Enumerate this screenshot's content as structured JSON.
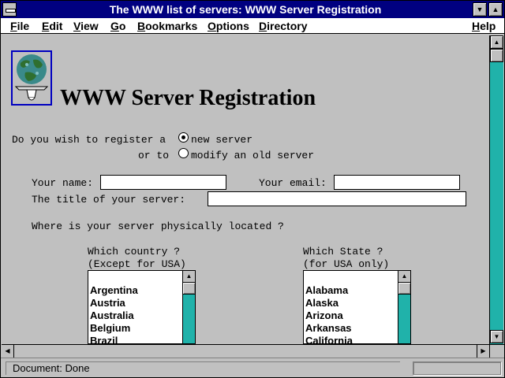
{
  "window": {
    "title": "The WWW list of servers: WWW Server Registration",
    "minimize_glyph": "▼",
    "maximize_glyph": "▲"
  },
  "menu": {
    "items": [
      {
        "label": "File"
      },
      {
        "label": "Edit"
      },
      {
        "label": "View"
      },
      {
        "label": "Go"
      },
      {
        "label": "Bookmarks"
      },
      {
        "label": "Options"
      },
      {
        "label": "Directory"
      },
      {
        "label": "Help"
      }
    ]
  },
  "page": {
    "heading": "WWW Server Registration",
    "register_prompt": "Do you wish to register a",
    "option_new": "new server",
    "or_to": "or to",
    "option_modify": "modify an old server",
    "name_label": "Your name:",
    "name_value": "",
    "email_label": "Your email:",
    "email_value": "",
    "server_title_label": "The title of your server:",
    "server_title_value": "",
    "location_question": "Where is your server physically located ?",
    "country_heading": "Which country ?",
    "country_subheading": "(Except for USA)",
    "countries": [
      "Argentina",
      "Austria",
      "Australia",
      "Belgium",
      "Brazil"
    ],
    "state_heading": "Which State ?",
    "state_subheading": "(for USA only)",
    "states": [
      "Alabama",
      "Alaska",
      "Arizona",
      "Arkansas",
      "California"
    ]
  },
  "status": {
    "text": "Document: Done"
  },
  "colors": {
    "titlebar": "#000080",
    "scrollbar_track": "#20b2aa",
    "background": "#c0c0c0"
  },
  "icons": {
    "logo": "globe-on-tray-icon",
    "scroll_up": "arrow-up-icon",
    "scroll_down": "arrow-down-icon",
    "scroll_left": "arrow-left-icon",
    "scroll_right": "arrow-right-icon"
  }
}
